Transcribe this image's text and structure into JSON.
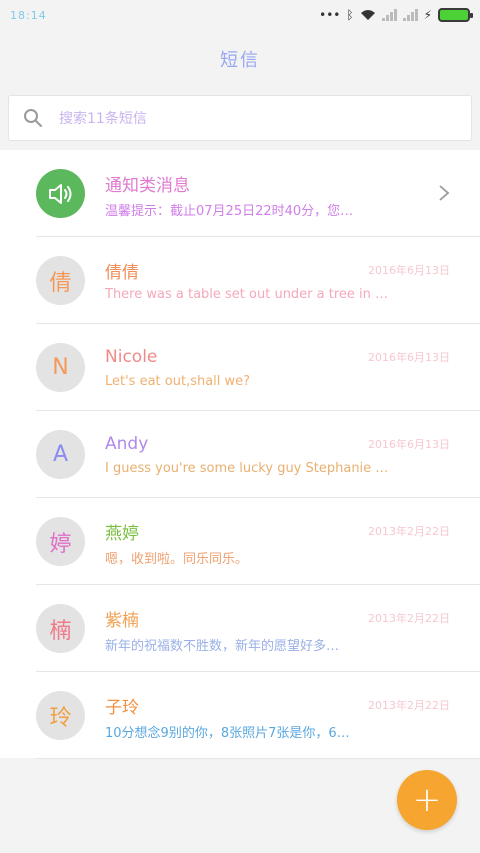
{
  "status_bar": {
    "time": "18:14",
    "icons": [
      "more-dots-icon",
      "bluetooth-icon",
      "wifi-icon",
      "signal-x-icon",
      "signal-x-icon",
      "charging-icon",
      "battery-icon"
    ]
  },
  "header": {
    "title": "短信"
  },
  "search": {
    "placeholder": "搜索11条短信"
  },
  "conversations": [
    {
      "avatar": "",
      "name": "通知类消息",
      "date": "",
      "preview": "温馨提示：截止07月25日22时40分，您…"
    },
    {
      "avatar": "倩",
      "name": "倩倩",
      "date": "2016年6月13日",
      "preview": "There was a table set out under a tree in …"
    },
    {
      "avatar": "N",
      "name": "Nicole",
      "date": "2016年6月13日",
      "preview": "Let's eat out,shall we?"
    },
    {
      "avatar": "A",
      "name": "Andy",
      "date": "2016年6月13日",
      "preview": "I guess you're some lucky guy Stephanie …"
    },
    {
      "avatar": "婷",
      "name": "燕婷",
      "date": "2013年2月22日",
      "preview": "嗯，收到啦。同乐同乐。"
    },
    {
      "avatar": "楠",
      "name": "紫楠",
      "date": "2013年2月22日",
      "preview": "新年的祝福数不胜数，新年的愿望好多…"
    },
    {
      "avatar": "玲",
      "name": "子玲",
      "date": "2013年2月22日",
      "preview": "10分想念9别的你，8张照片7张是你，6…"
    }
  ],
  "fab": {
    "label": "+"
  },
  "colors": {
    "accent_green": "#5cb85c",
    "fab_orange": "#f5a530",
    "date_pink": "#f6c8cf",
    "title_lavender": "#9aa7f0"
  }
}
